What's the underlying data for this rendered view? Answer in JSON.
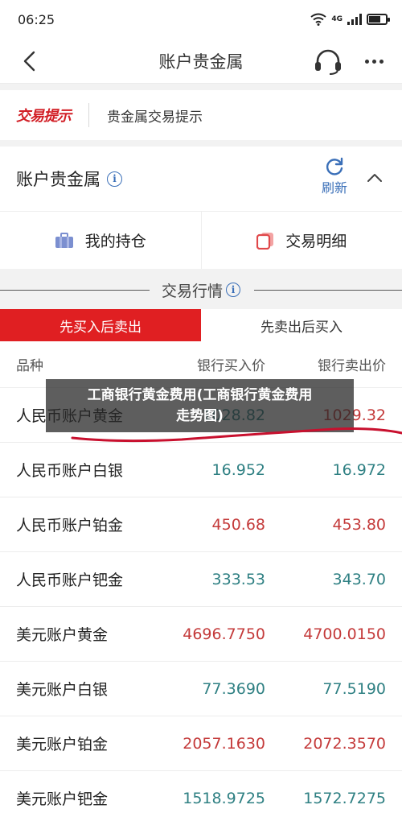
{
  "status_bar": {
    "time": "06:25",
    "network": "4G"
  },
  "nav": {
    "title": "账户贵金属"
  },
  "notice": {
    "logo_text": "交易提示",
    "text": "贵金属交易提示"
  },
  "account": {
    "title": "账户贵金属",
    "refresh_label": "刷新"
  },
  "actions": [
    {
      "label": "我的持仓"
    },
    {
      "label": "交易明细"
    }
  ],
  "market": {
    "title": "交易行情"
  },
  "tabs": [
    {
      "label": "先买入后卖出",
      "active": true
    },
    {
      "label": "先卖出后买入",
      "active": false
    }
  ],
  "table": {
    "headers": {
      "name": "品种",
      "buy": "银行买入价",
      "sell": "银行卖出价"
    },
    "rows": [
      {
        "name": "人民币账户黄金",
        "buy": "1028.82",
        "sell": "1029.32",
        "buy_color": "teal",
        "sell_color": "red"
      },
      {
        "name": "人民币账户白银",
        "buy": "16.952",
        "sell": "16.972",
        "buy_color": "teal",
        "sell_color": "teal"
      },
      {
        "name": "人民币账户铂金",
        "buy": "450.68",
        "sell": "453.80",
        "buy_color": "red",
        "sell_color": "red"
      },
      {
        "name": "人民币账户钯金",
        "buy": "333.53",
        "sell": "343.70",
        "buy_color": "teal",
        "sell_color": "teal"
      },
      {
        "name": "美元账户黄金",
        "buy": "4696.7750",
        "sell": "4700.0150",
        "buy_color": "red",
        "sell_color": "red"
      },
      {
        "name": "美元账户白银",
        "buy": "77.3690",
        "sell": "77.5190",
        "buy_color": "teal",
        "sell_color": "teal"
      },
      {
        "name": "美元账户铂金",
        "buy": "2057.1630",
        "sell": "2072.3570",
        "buy_color": "red",
        "sell_color": "red"
      },
      {
        "name": "美元账户钯金",
        "buy": "1518.9725",
        "sell": "1572.7275",
        "buy_color": "teal",
        "sell_color": "teal"
      }
    ]
  },
  "overlay": {
    "line1": "工商银行黄金费用(工商银行黄金费用",
    "line2": "走势图)"
  },
  "colors": {
    "accent_red": "#e01f22",
    "link_blue": "#3a6fb8",
    "teal": "#2f8083",
    "price_red": "#c43a3a"
  }
}
